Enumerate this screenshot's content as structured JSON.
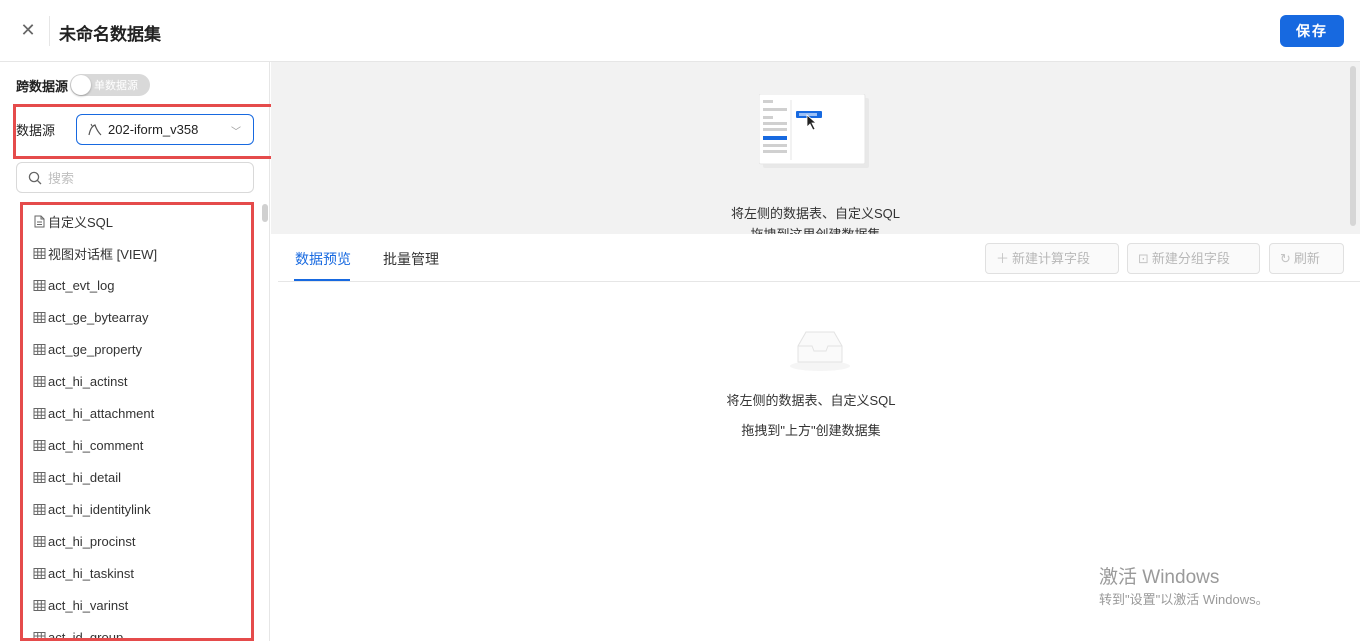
{
  "header": {
    "close_icon": "close-icon",
    "title": "未命名数据集",
    "save_label": "保存"
  },
  "sidebar": {
    "cross_source_label": "跨数据源",
    "toggle_text": "单数据源",
    "datasource_label": "数据源",
    "datasource_value": "202-iform_v358",
    "search_placeholder": "搜索",
    "items": [
      {
        "label": "自定义SQL",
        "icon": "sql-file-icon"
      },
      {
        "label": "视图对话框 [VIEW]",
        "icon": "table-icon"
      },
      {
        "label": "act_evt_log",
        "icon": "table-icon"
      },
      {
        "label": "act_ge_bytearray",
        "icon": "table-icon"
      },
      {
        "label": "act_ge_property",
        "icon": "table-icon"
      },
      {
        "label": "act_hi_actinst",
        "icon": "table-icon"
      },
      {
        "label": "act_hi_attachment",
        "icon": "table-icon"
      },
      {
        "label": "act_hi_comment",
        "icon": "table-icon"
      },
      {
        "label": "act_hi_detail",
        "icon": "table-icon"
      },
      {
        "label": "act_hi_identitylink",
        "icon": "table-icon"
      },
      {
        "label": "act_hi_procinst",
        "icon": "table-icon"
      },
      {
        "label": "act_hi_taskinst",
        "icon": "table-icon"
      },
      {
        "label": "act_hi_varinst",
        "icon": "table-icon"
      },
      {
        "label": "act_id_group",
        "icon": "table-icon"
      }
    ]
  },
  "canvas": {
    "hint_line1": "将左侧的数据表、自定义SQL",
    "hint_line2": "拖拽到这里创建数据集"
  },
  "bottom": {
    "tabs": [
      {
        "label": "数据预览",
        "active": true
      },
      {
        "label": "批量管理",
        "active": false
      }
    ],
    "new_calc_field": "新建计算字段",
    "new_group_field": "新建分组字段",
    "refresh": "刷新",
    "empty_line1": "将左侧的数据表、自定义SQL",
    "empty_line2": "拖拽到\"上方\"创建数据集"
  },
  "watermark": {
    "line1": "激活 Windows",
    "line2": "转到\"设置\"以激活 Windows。"
  },
  "colors": {
    "accent": "#1769e0",
    "highlight_border": "#e54b4b",
    "canvas_bg": "#f2f2f2"
  }
}
